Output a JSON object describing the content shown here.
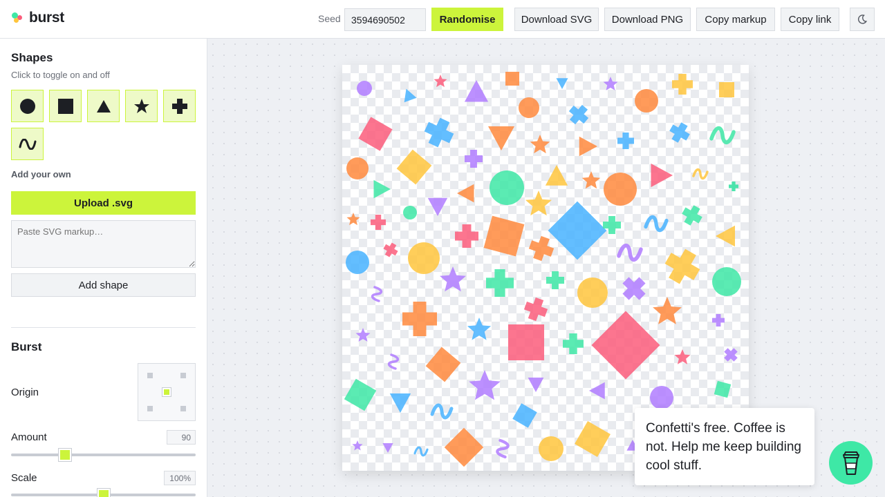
{
  "app": {
    "name": "burst"
  },
  "header": {
    "seed_label": "Seed",
    "seed_value": "3594690502",
    "randomise": "Randomise",
    "download_svg": "Download SVG",
    "download_png": "Download PNG",
    "copy_markup": "Copy markup",
    "copy_link": "Copy link",
    "theme_icon": "moon-icon"
  },
  "sidebar": {
    "shapes_title": "Shapes",
    "shapes_subtitle": "Click to toggle on and off",
    "shapes": [
      {
        "name": "circle",
        "icon": "circle-icon",
        "enabled": true
      },
      {
        "name": "square",
        "icon": "square-icon",
        "enabled": true
      },
      {
        "name": "triangle",
        "icon": "triangle-icon",
        "enabled": true
      },
      {
        "name": "star",
        "icon": "star-icon",
        "enabled": true
      },
      {
        "name": "cross",
        "icon": "cross-icon",
        "enabled": true
      },
      {
        "name": "squiggle",
        "icon": "squiggle-icon",
        "enabled": true
      }
    ],
    "add_own_label": "Add your own",
    "upload_label": "Upload .svg",
    "svg_placeholder": "Paste SVG markup…",
    "add_shape_label": "Add shape",
    "burst_title": "Burst",
    "origin_label": "Origin",
    "origin_selected": "center",
    "amount_label": "Amount",
    "amount_value": "90",
    "amount_fraction": 0.31,
    "scale_label": "Scale",
    "scale_value": "100%",
    "scale_fraction": 0.5
  },
  "palette": {
    "pink": "#fb5d7b",
    "orange": "#ff8a3d",
    "yellow": "#ffc53d",
    "green": "#3ee8a6",
    "teal": "#2fe0a0",
    "blue": "#48b3ff",
    "purple": "#b07cff",
    "accent": "#ccf43b"
  },
  "support": {
    "message": "Confetti's free. Coffee is not. Help me keep building cool stuff.",
    "coffee_icon": "coffee-cup-icon"
  }
}
